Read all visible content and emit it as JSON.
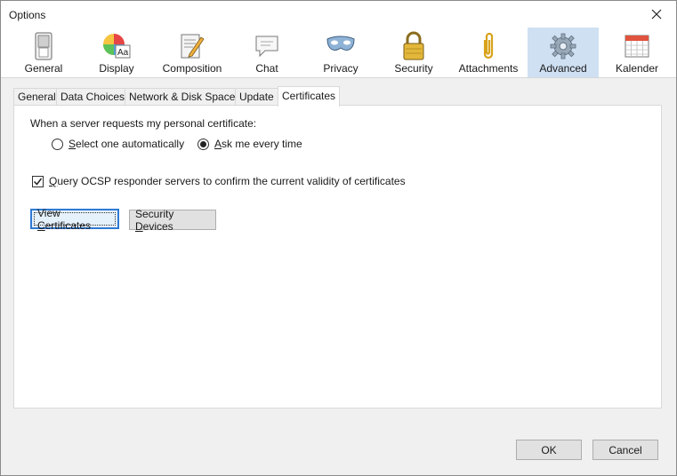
{
  "window": {
    "title": "Options"
  },
  "categories": [
    {
      "label": "General",
      "icon": "switch-icon"
    },
    {
      "label": "Display",
      "icon": "color-wheel-icon"
    },
    {
      "label": "Composition",
      "icon": "compose-icon"
    },
    {
      "label": "Chat",
      "icon": "chat-bubble-icon"
    },
    {
      "label": "Privacy",
      "icon": "mask-icon"
    },
    {
      "label": "Security",
      "icon": "padlock-icon"
    },
    {
      "label": "Attachments",
      "icon": "paperclip-icon"
    },
    {
      "label": "Advanced",
      "icon": "gear-icon",
      "selected": true
    },
    {
      "label": "Kalender",
      "icon": "calendar-icon"
    }
  ],
  "subtabs": [
    "General",
    "Data Choices",
    "Network & Disk Space",
    "Update",
    "Certificates"
  ],
  "active_subtab": "Certificates",
  "certificates": {
    "request_label": "When a server requests my personal certificate:",
    "radio_auto": {
      "prefix": "S",
      "rest": "elect one automatically",
      "checked": false
    },
    "radio_ask": {
      "prefix": "A",
      "rest": "sk me every time",
      "checked": true
    },
    "ocsp": {
      "prefix": "Q",
      "rest": "uery OCSP responder servers to confirm the current validity of certificates",
      "checked": true
    },
    "view_btn": {
      "before": "View ",
      "key": "C",
      "after": "ertificates"
    },
    "devices_btn": {
      "before": "Security ",
      "key": "D",
      "after": "evices"
    }
  },
  "footer": {
    "ok": "OK",
    "cancel": "Cancel"
  },
  "colors": {
    "selected_category": "#cfe0f3",
    "focus_border": "#2f7ad4"
  }
}
